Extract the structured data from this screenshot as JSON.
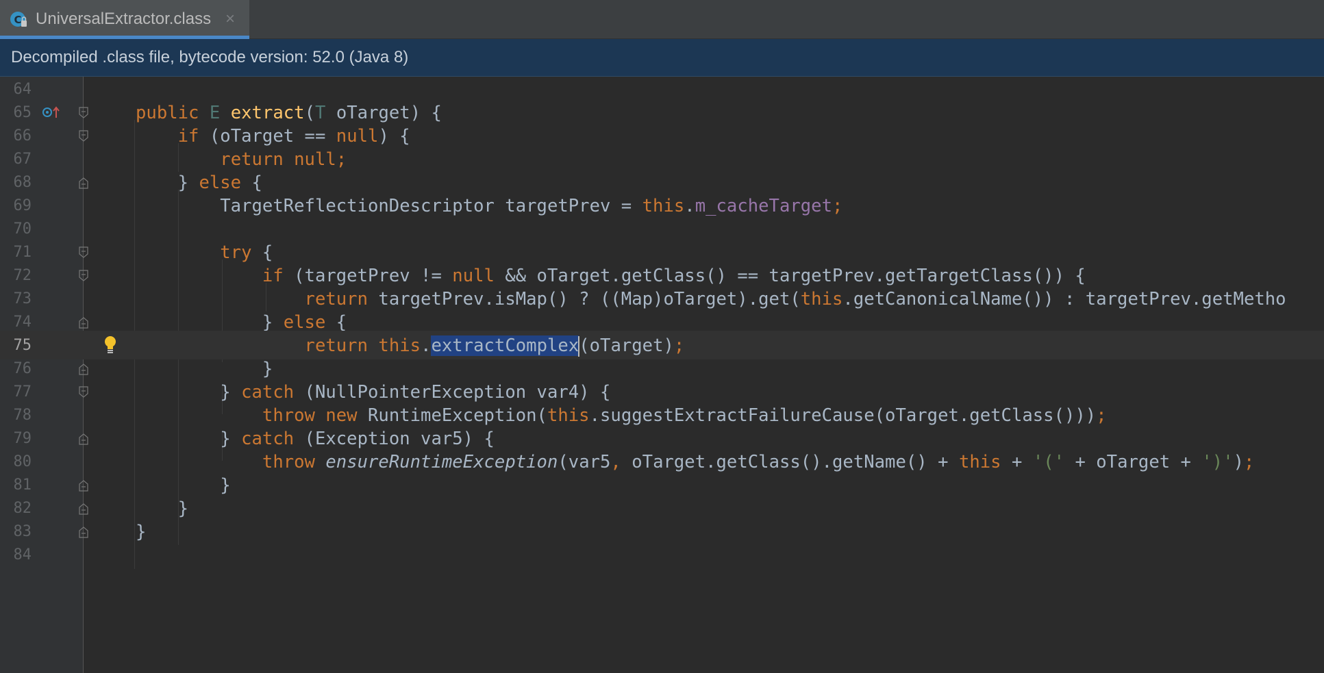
{
  "tab": {
    "title": "UniversalExtractor.class",
    "close_glyph": "×",
    "icon": "java-class-icon"
  },
  "banner": {
    "text": "Decompiled .class file, bytecode version: 52.0 (Java 8)"
  },
  "editor": {
    "current_line": "75",
    "lines": [
      {
        "num": "64",
        "code": ""
      },
      {
        "num": "65",
        "code": "public E extract(T oTarget) {"
      },
      {
        "num": "66",
        "code": "if (oTarget == null) {"
      },
      {
        "num": "67",
        "code": "return null;"
      },
      {
        "num": "68",
        "code": "} else {"
      },
      {
        "num": "69",
        "code": "TargetReflectionDescriptor targetPrev = this.m_cacheTarget;"
      },
      {
        "num": "70",
        "code": ""
      },
      {
        "num": "71",
        "code": "try {"
      },
      {
        "num": "72",
        "code": "if (targetPrev != null && oTarget.getClass() == targetPrev.getTargetClass()) {"
      },
      {
        "num": "73",
        "code": "return targetPrev.isMap() ? ((Map)oTarget).get(this.getCanonicalName()) : targetPrev.getMetho"
      },
      {
        "num": "74",
        "code": "} else {"
      },
      {
        "num": "75",
        "code": "return this.extractComplex(oTarget);"
      },
      {
        "num": "76",
        "code": "}"
      },
      {
        "num": "77",
        "code": "} catch (NullPointerException var4) {"
      },
      {
        "num": "78",
        "code": "throw new RuntimeException(this.suggestExtractFailureCause(oTarget.getClass()));"
      },
      {
        "num": "79",
        "code": "} catch (Exception var5) {"
      },
      {
        "num": "80",
        "code": "throw ensureRuntimeException(var5, oTarget.getClass().getName() + this + '(' + oTarget + ')');"
      },
      {
        "num": "81",
        "code": "}"
      },
      {
        "num": "82",
        "code": "}"
      },
      {
        "num": "83",
        "code": "}"
      },
      {
        "num": "84",
        "code": ""
      }
    ],
    "selection": "extractComplex"
  },
  "colors": {
    "keyword": "#cc7832",
    "method_decl": "#ffc66d",
    "field": "#9876aa",
    "string": "#6a8759",
    "type_param": "#507874",
    "text": "#a9b7c6",
    "selection": "#214283",
    "banner_bg": "#1c3754",
    "tab_accent": "#4a88c7"
  }
}
